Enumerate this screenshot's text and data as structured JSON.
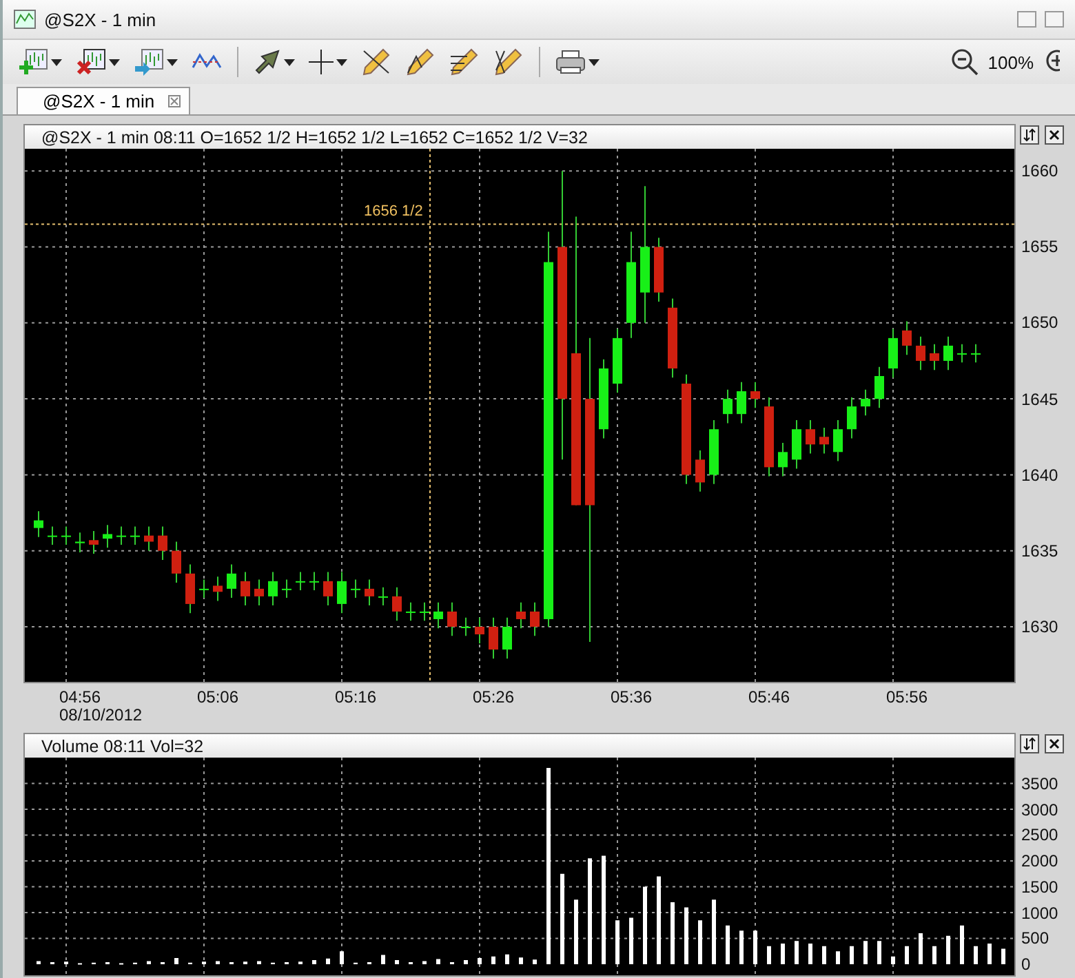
{
  "window": {
    "title": "@S2X - 1 min"
  },
  "toolbar": {
    "zoom": "100%"
  },
  "tabs": [
    {
      "label": "@S2X - 1 min",
      "selected": true
    }
  ],
  "price_pane": {
    "header": "@S2X - 1 min 08:11 O=1652 1/2 H=1652 1/2 L=1652 C=1652 1/2 V=32",
    "price_labels": [
      "1660",
      "1655",
      "1650",
      "1645",
      "1640",
      "1635",
      "1630"
    ],
    "cursor_label": "1656 1/2",
    "time_labels": [
      {
        "time": "04:56",
        "date": "08/10/2012"
      },
      {
        "time": "05:06"
      },
      {
        "time": "05:16"
      },
      {
        "time": "05:26"
      },
      {
        "time": "05:36"
      },
      {
        "time": "05:46"
      },
      {
        "time": "05:56"
      }
    ]
  },
  "volume_pane": {
    "header": "Volume 08:11 Vol=32",
    "chart_data": {
      "type": "bar",
      "grid": true,
      "ylim": [
        0,
        4000
      ],
      "yticks": [
        {
          "value": 0,
          "label": "0"
        },
        {
          "value": 500,
          "label": "500"
        },
        {
          "value": 1000,
          "label": "1000"
        },
        {
          "value": 1500,
          "label": "1500"
        },
        {
          "value": 2000,
          "label": "2000"
        },
        {
          "value": 2500,
          "label": "2500"
        },
        {
          "value": 3000,
          "label": "3000"
        },
        {
          "value": 3500,
          "label": "3500"
        }
      ],
      "values": [
        60,
        40,
        50,
        20,
        30,
        40,
        20,
        30,
        60,
        40,
        120,
        30,
        50,
        60,
        40,
        50,
        60,
        30,
        40,
        50,
        80,
        110,
        250,
        30,
        40,
        180,
        80,
        40,
        60,
        100,
        40,
        80,
        120,
        150,
        190,
        130,
        90,
        3800,
        1750,
        1250,
        2050,
        2100,
        850,
        900,
        1500,
        1700,
        1200,
        1100,
        850,
        1250,
        750,
        650,
        650,
        350,
        400,
        450,
        400,
        350,
        250,
        350,
        450,
        450,
        150,
        350,
        600,
        350,
        550,
        750,
        350,
        400,
        300
      ]
    }
  }
}
